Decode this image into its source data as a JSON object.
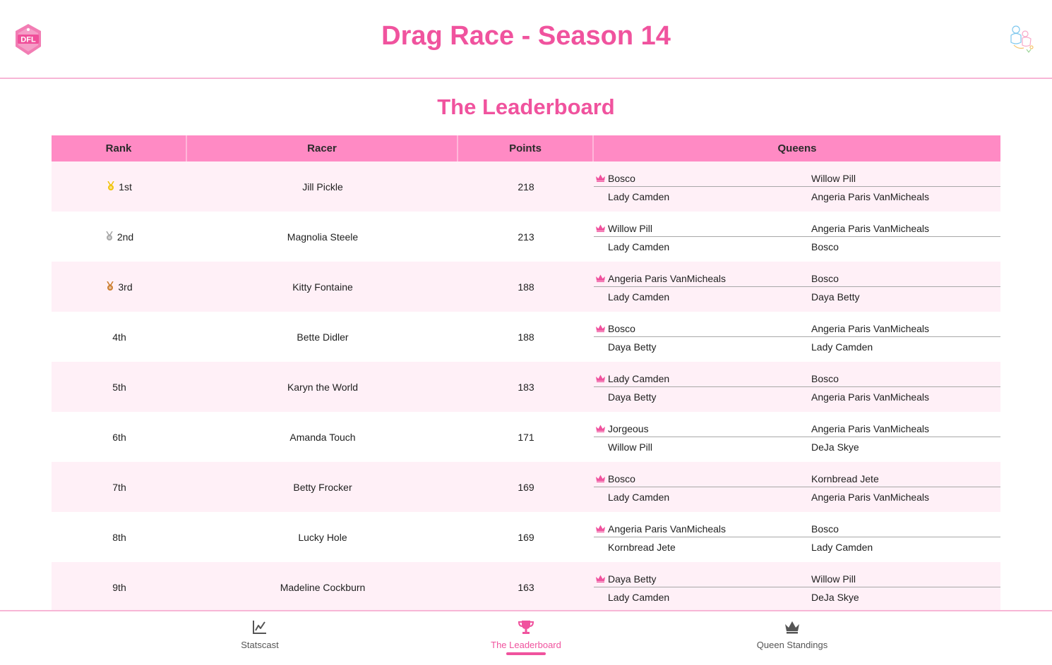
{
  "header": {
    "title": "Drag Race - Season 14",
    "logo_icon": "dfl-logo-icon",
    "avatar_icon": "user-avatar-icon"
  },
  "section_title": "The Leaderboard",
  "table": {
    "columns": [
      "Rank",
      "Racer",
      "Points",
      "Queens"
    ],
    "rows": [
      {
        "rank": "1st",
        "medal": "gold",
        "racer": "Jill Pickle",
        "points": "218",
        "queens": [
          "Bosco",
          "Willow Pill",
          "Lady Camden",
          "Angeria Paris VanMicheals"
        ]
      },
      {
        "rank": "2nd",
        "medal": "silver",
        "racer": "Magnolia Steele",
        "points": "213",
        "queens": [
          "Willow Pill",
          "Angeria Paris VanMicheals",
          "Lady Camden",
          "Bosco"
        ]
      },
      {
        "rank": "3rd",
        "medal": "bronze",
        "racer": "Kitty Fontaine",
        "points": "188",
        "queens": [
          "Angeria Paris VanMicheals",
          "Bosco",
          "Lady Camden",
          "Daya Betty"
        ]
      },
      {
        "rank": "4th",
        "medal": "",
        "racer": "Bette Didler",
        "points": "188",
        "queens": [
          "Bosco",
          "Angeria Paris VanMicheals",
          "Daya Betty",
          "Lady Camden"
        ]
      },
      {
        "rank": "5th",
        "medal": "",
        "racer": "Karyn the World",
        "points": "183",
        "queens": [
          "Lady Camden",
          "Bosco",
          "Daya Betty",
          "Angeria Paris VanMicheals"
        ]
      },
      {
        "rank": "6th",
        "medal": "",
        "racer": "Amanda Touch",
        "points": "171",
        "queens": [
          "Jorgeous",
          "Angeria Paris VanMicheals",
          "Willow Pill",
          "DeJa Skye"
        ]
      },
      {
        "rank": "7th",
        "medal": "",
        "racer": "Betty Frocker",
        "points": "169",
        "queens": [
          "Bosco",
          "Kornbread Jete",
          "Lady Camden",
          "Angeria Paris VanMicheals"
        ]
      },
      {
        "rank": "8th",
        "medal": "",
        "racer": "Lucky Hole",
        "points": "169",
        "queens": [
          "Angeria Paris VanMicheals",
          "Bosco",
          "Kornbread Jete",
          "Lady Camden"
        ]
      },
      {
        "rank": "9th",
        "medal": "",
        "racer": "Madeline Cockburn",
        "points": "163",
        "queens": [
          "Daya Betty",
          "Willow Pill",
          "Lady Camden",
          "DeJa Skye"
        ]
      }
    ]
  },
  "nav": {
    "items": [
      {
        "label": "Statscast",
        "icon": "chart-line-icon",
        "active": false
      },
      {
        "label": "The Leaderboard",
        "icon": "trophy-icon",
        "active": true
      },
      {
        "label": "Queen Standings",
        "icon": "crown-icon",
        "active": false
      }
    ]
  },
  "colors": {
    "accent": "#f0539e",
    "header_row": "#ff8ac4",
    "alt_row": "#fff0f7",
    "divider": "#f7b6d6",
    "gold": "#f1c40f",
    "silver": "#a9a9a9",
    "bronze": "#cd7f32"
  }
}
